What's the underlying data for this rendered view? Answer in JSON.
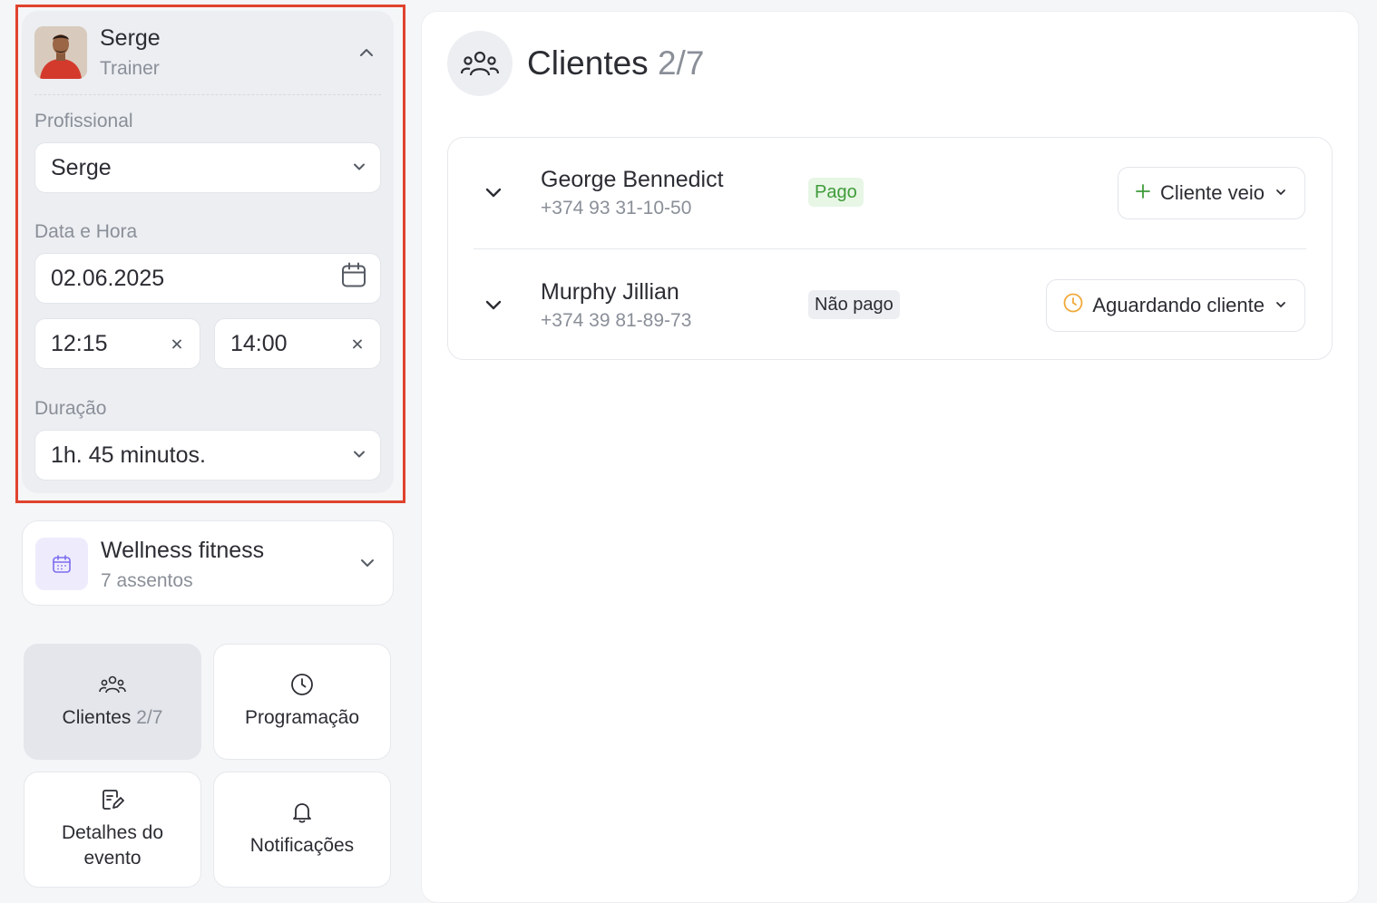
{
  "trainer": {
    "name": "Serge",
    "role": "Trainer"
  },
  "form": {
    "professional_label": "Profissional",
    "professional_value": "Serge",
    "datetime_label": "Data e Hora",
    "date_value": "02.06.2025",
    "start_time": "12:15",
    "end_time": "14:00",
    "duration_label": "Duração",
    "duration_value": "1h. 45 minutos."
  },
  "event": {
    "title": "Wellness fitness",
    "seats": "7 assentos"
  },
  "nav": {
    "clients_label": "Clientes",
    "clients_count": "2/7",
    "schedule_label": "Programação",
    "details_line1": "Detalhes do",
    "details_line2": "evento",
    "notifications_label": "Notificações"
  },
  "main": {
    "title": "Clientes",
    "count": "2/7"
  },
  "clients": [
    {
      "name": "George Bennedict",
      "phone": "+374 93 31-10-50",
      "payment": "Pago",
      "status": "Cliente veio"
    },
    {
      "name": "Murphy Jillian",
      "phone": "+374 39 81-89-73",
      "payment": "Não pago",
      "status": "Aguardando cliente"
    }
  ],
  "colors": {
    "highlight": "#e0432e",
    "paid_green": "#3f9b3a",
    "waiting_orange": "#f0a93a",
    "event_purple": "#7b6cf0"
  }
}
